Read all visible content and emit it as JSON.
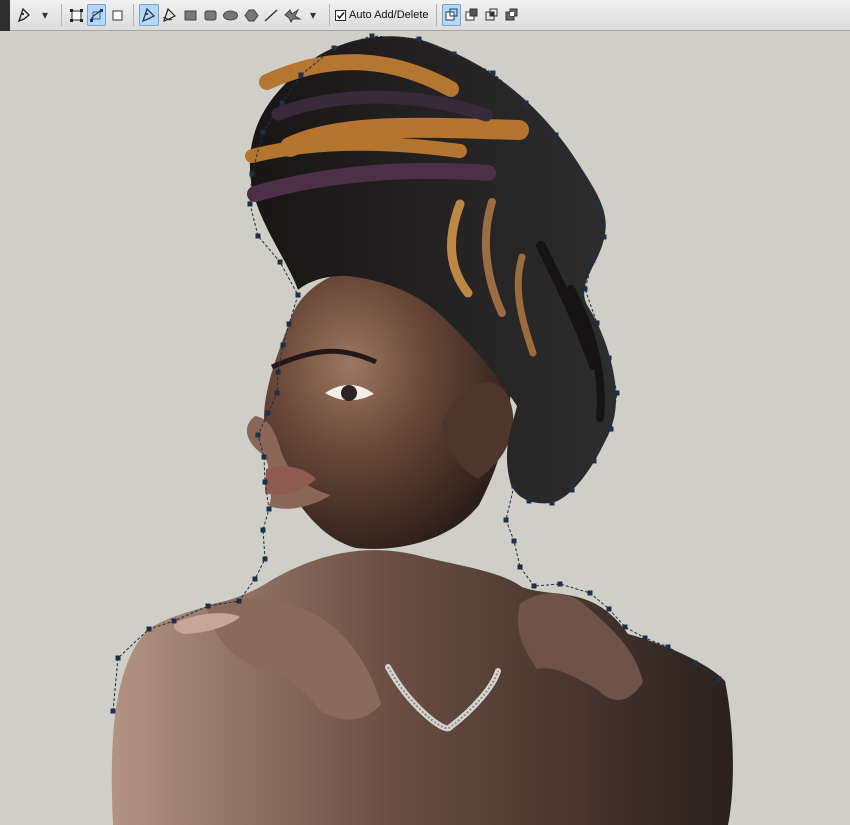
{
  "toolbar": {
    "tool_icons": [
      "pen-icon",
      "dropdown-arrow-icon",
      "shape-layers-icon",
      "paths-icon",
      "fill-pixels-icon",
      "pen-tool-icon",
      "freeform-pen-tool-icon",
      "rectangle-tool-icon",
      "rounded-rectangle-tool-icon",
      "ellipse-tool-icon",
      "polygon-tool-icon",
      "line-tool-icon",
      "custom-shape-tool-icon",
      "custom-shape-dropdown-icon",
      "add-to-path-area-icon",
      "subtract-from-path-area-icon",
      "intersect-path-areas-icon",
      "exclude-overlapping-path-areas-icon"
    ],
    "auto_add_delete": {
      "label": "Auto Add/Delete",
      "checked": true
    },
    "selected_path_mode": "paths",
    "selected_drawing_tool": "pen",
    "selected_path_operation": "add"
  },
  "canvas": {
    "subject": "portrait-photo",
    "path_color": "#1f2f46",
    "background_color": "#cfcfc8"
  }
}
